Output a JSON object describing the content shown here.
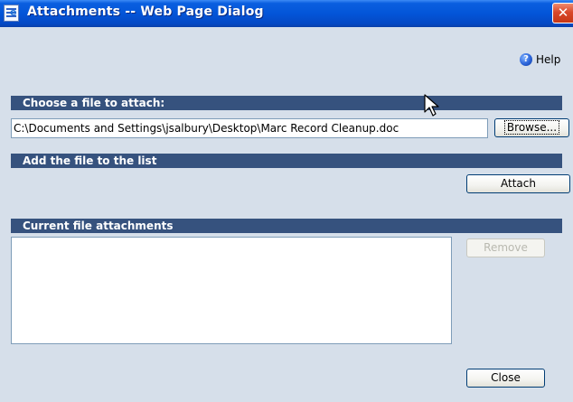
{
  "window": {
    "title": "Attachments -- Web Page Dialog",
    "close_glyph": "✕",
    "icon": "ie-document-icon"
  },
  "help": {
    "label": "Help",
    "icon": "help-icon"
  },
  "sections": {
    "choose": "Choose a file to attach:",
    "add": "Add the file to the list",
    "current": "Current file attachments"
  },
  "file_input": {
    "value": "C:\\Documents and Settings\\jsalbury\\Desktop\\Marc Record Cleanup.doc"
  },
  "buttons": {
    "browse": "Browse...",
    "attach": "Attach",
    "remove": "Remove",
    "close": "Close"
  },
  "attachments": [],
  "colors": {
    "titlebar": "#0355d8",
    "section_header": "#36527e",
    "dialog_background": "#d6dfea",
    "close_button": "#d9482b"
  }
}
